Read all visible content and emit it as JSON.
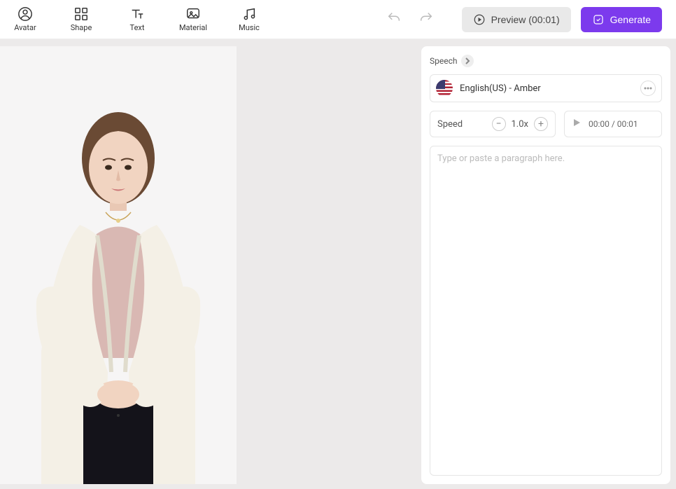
{
  "toolbar": {
    "avatar": "Avatar",
    "shape": "Shape",
    "text": "Text",
    "material": "Material",
    "music": "Music"
  },
  "actions": {
    "preview": "Preview (00:01)",
    "generate": "Generate"
  },
  "panel": {
    "tab": "Speech",
    "voice": "English(US) - Amber",
    "speed_label": "Speed",
    "speed_value": "1.0x",
    "time": "00:00 / 00:01",
    "placeholder": "Type or paste a paragraph here."
  }
}
